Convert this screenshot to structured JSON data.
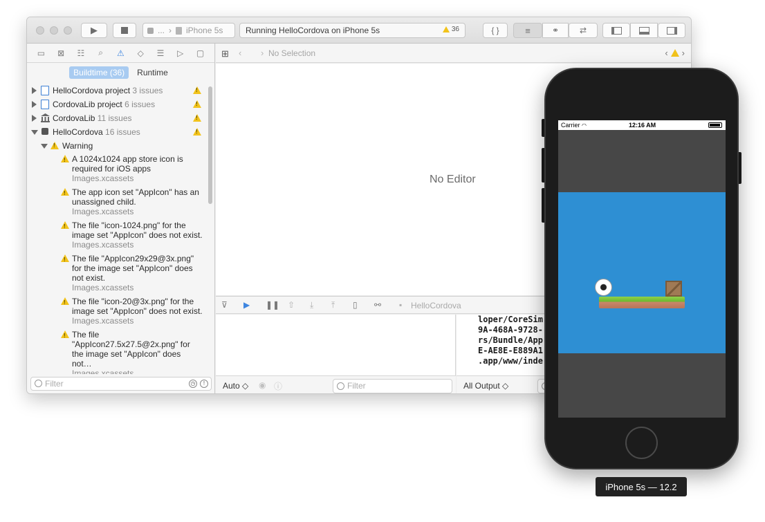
{
  "toolbar": {
    "scheme_ellipsis": "...",
    "scheme_device": "iPhone 5s",
    "activity_text": "Running HelloCordova on iPhone 5s",
    "warning_count": "36",
    "braces_label": "{ }"
  },
  "navigator": {
    "segments": {
      "buildtime": "Buildtime (36)",
      "runtime": "Runtime"
    },
    "groups": [
      {
        "name": "HelloCordova project",
        "count": "3 issues"
      },
      {
        "name": "CordovaLib project",
        "count": "6 issues"
      },
      {
        "name": "CordovaLib",
        "count": "11 issues"
      },
      {
        "name": "HelloCordova",
        "count": "16 issues"
      }
    ],
    "warning_label": "Warning",
    "issues": [
      {
        "message": "A 1024x1024 app store icon is required for iOS apps",
        "file": "Images.xcassets"
      },
      {
        "message": "The app icon set \"AppIcon\" has an unassigned child.",
        "file": "Images.xcassets"
      },
      {
        "message": "The file \"icon-1024.png\" for the image set \"AppIcon\" does not exist.",
        "file": "Images.xcassets"
      },
      {
        "message": "The file \"AppIcon29x29@3x.png\" for the image set \"AppIcon\" does not exist.",
        "file": "Images.xcassets"
      },
      {
        "message": "The file \"icon-20@3x.png\" for the image set \"AppIcon\" does not exist.",
        "file": "Images.xcassets"
      },
      {
        "message": "The file \"AppIcon27.5x27.5@2x.png\" for the image set \"AppIcon\" does not…",
        "file": "Images.xcassets"
      }
    ],
    "filter_placeholder": "Filter"
  },
  "editor": {
    "no_selection": "No Selection",
    "no_editor": "No Editor"
  },
  "debug": {
    "process_label": "HelloCordova",
    "auto_label": "Auto ◇",
    "filter_placeholder": "Filter",
    "output_label": "All Output ◇",
    "console_lines": [
      "loper/CoreSim",
      "9A-468A-9728-",
      "rs/Bundle/App",
      "E-AE8E-E889A1",
      ".app/www/inde"
    ]
  },
  "simulator": {
    "carrier": "Carrier",
    "time": "12:16 AM",
    "title": "iPhone 5s — 12.2"
  },
  "colors": {
    "accent": "#3f86e0",
    "warning": "#f2c31b",
    "game_background": "#2e8fd3",
    "grass": "#6ab52e"
  }
}
